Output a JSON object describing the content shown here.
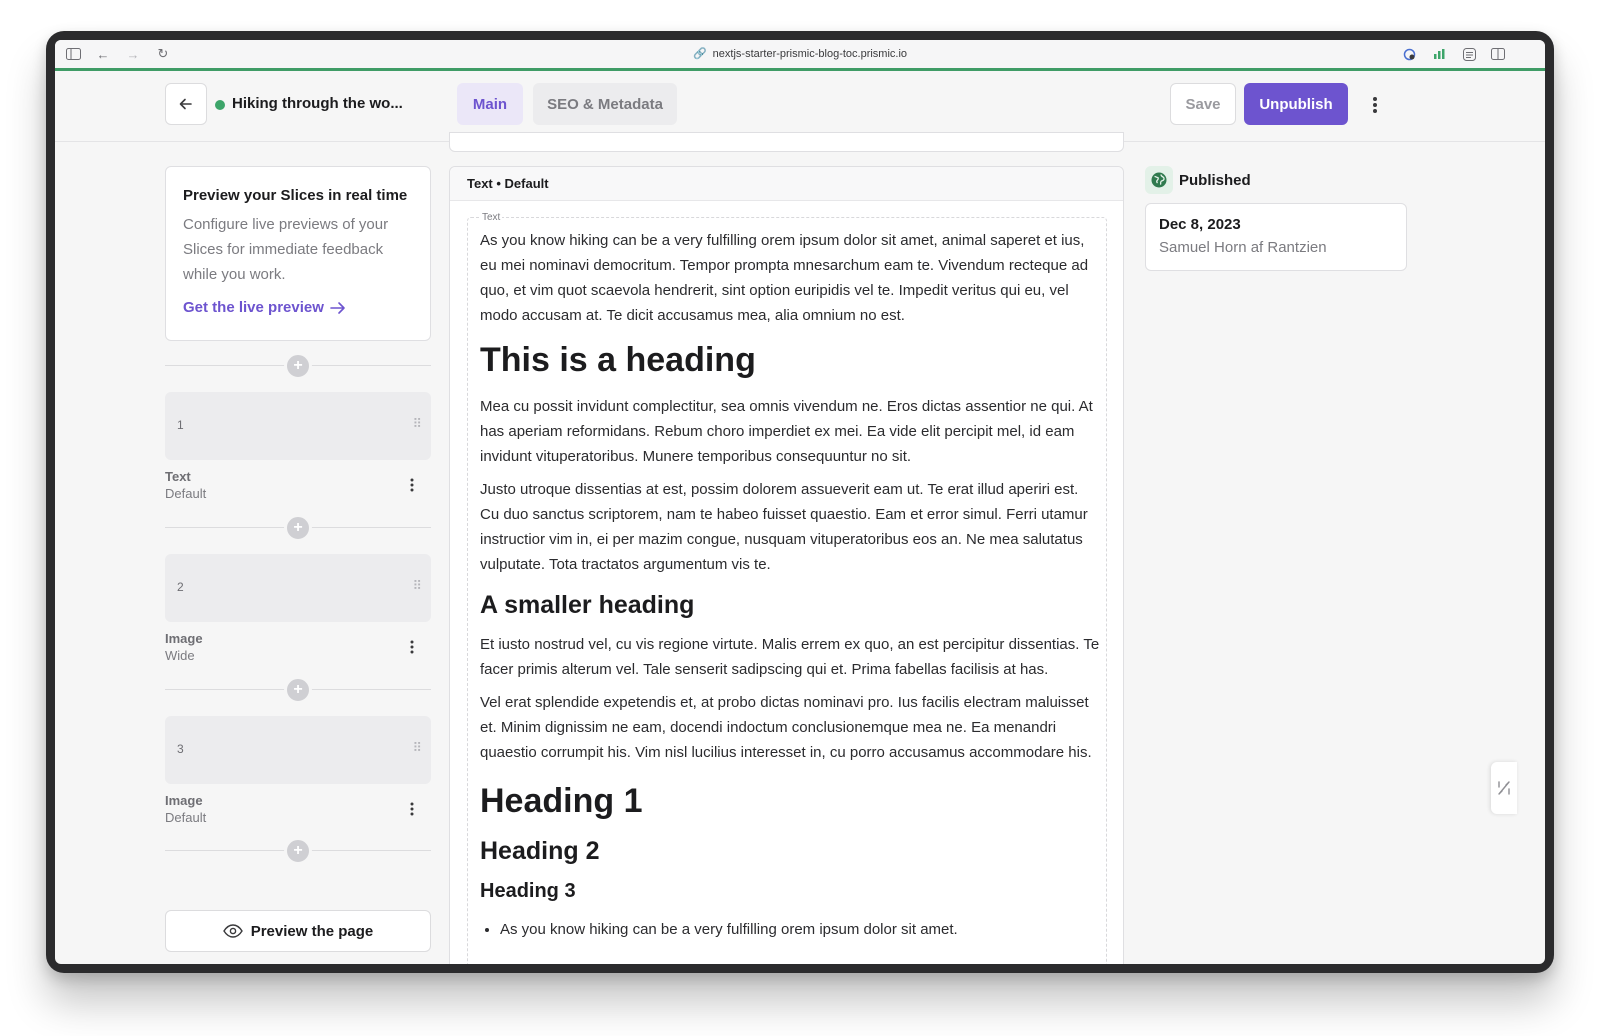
{
  "browser": {
    "url": "nextjs-starter-prismic-blog-toc.prismic.io"
  },
  "header": {
    "title": "Hiking through the wo...",
    "tabs": [
      {
        "label": "Main",
        "active": true
      },
      {
        "label": "SEO & Metadata",
        "active": false
      }
    ],
    "save_label": "Save",
    "unpublish_label": "Unpublish"
  },
  "preview_card": {
    "title": "Preview your Slices in real time",
    "text": "Configure live previews of your Slices for immediate feedback while you work.",
    "link": "Get the live preview"
  },
  "slices": [
    {
      "number": "1",
      "type": "Text",
      "variation": "Default"
    },
    {
      "number": "2",
      "type": "Image",
      "variation": "Wide"
    },
    {
      "number": "3",
      "type": "Image",
      "variation": "Default"
    }
  ],
  "preview_page_label": "Preview the page",
  "editor": {
    "slice_title": "Text • Default",
    "field_label": "Text",
    "paragraph_1": "As you know hiking can be a very fulfilling orem ipsum dolor sit amet, animal saperet et ius, eu mei nominavi democritum. Tempor prompta mnesarchum eam te. Vivendum recteque ad quo, et vim quot scaevola hendrerit, sint option euripidis vel te. Impedit veritus qui eu, vel modo accusam at. Te dicit accusamus mea, alia omnium no est.",
    "heading_1": "This is a heading",
    "paragraph_2": "Mea cu possit invidunt complectitur, sea omnis vivendum ne. Eros dictas assentior ne qui. At has aperiam reformidans. Rebum choro imperdiet ex mei. Ea vide elit percipit mel, id eam invidunt vituperatoribus. Munere temporibus consequuntur no sit.",
    "paragraph_3": "Justo utroque dissentias at est, possim dolorem assueverit eam ut. Te erat illud aperiri est. Cu duo sanctus scriptorem, nam te habeo fuisset quaestio. Eam et error simul. Ferri utamur instructior vim in, ei per mazim congue, nusquam vituperatoribus eos an. Ne mea salutatus vulputate. Tota tractatos argumentum vis te.",
    "heading_2": "A smaller heading",
    "paragraph_4": "Et iusto nostrud vel, cu vis regione virtute. Malis errem ex quo, an est percipitur dissentias. Te facer primis alterum vel. Tale senserit sadipscing qui et. Prima fabellas facilisis at has.",
    "paragraph_5": "Vel erat splendide expetendis et, at probo dictas nominavi pro. Ius facilis electram maluisset et. Minim dignissim ne eam, docendi indoctum conclusionemque mea ne. Ea menandri quaestio corrumpit his. Vim nisl lucilius interesset in, cu porro accusamus accommodare his.",
    "heading_h1": "Heading 1",
    "heading_h2": "Heading 2",
    "heading_h3": "Heading 3",
    "bullet_1": "As you know hiking can be a very fulfilling orem ipsum dolor sit amet."
  },
  "status": {
    "label": "Published",
    "date": "Dec 8, 2023",
    "author": "Samuel Horn af Rantzien"
  },
  "colors": {
    "accent": "#6d54cf",
    "published": "#3da56a"
  }
}
